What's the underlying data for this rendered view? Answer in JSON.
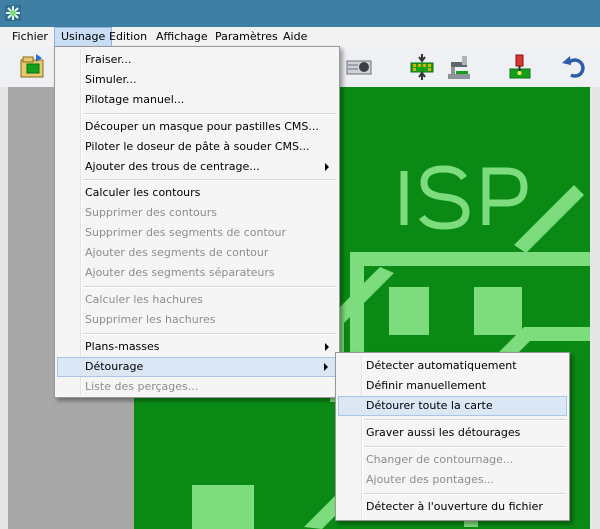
{
  "menubar": {
    "items": [
      {
        "label": "Fichier"
      },
      {
        "label": "Usinage"
      },
      {
        "label": "Edition"
      },
      {
        "label": "Affichage"
      },
      {
        "label": "Paramètres"
      },
      {
        "label": "Aide"
      }
    ]
  },
  "board": {
    "label": "ISP",
    "colors": {
      "board": "#0a8a14",
      "copper": "#7ddc7d"
    }
  },
  "usinage_menu": {
    "items": [
      {
        "label": "Fraiser..."
      },
      {
        "label": "Simuler..."
      },
      {
        "label": "Pilotage manuel..."
      },
      {
        "label": "Découper un masque pour pastilles CMS..."
      },
      {
        "label": "Piloter le doseur de pâte à souder CMS..."
      },
      {
        "label": "Ajouter des trous de centrage..."
      },
      {
        "label": "Calculer les contours"
      },
      {
        "label": "Supprimer des contours"
      },
      {
        "label": "Supprimer des segments de contour"
      },
      {
        "label": "Ajouter des segments de contour"
      },
      {
        "label": "Ajouter des segments séparateurs"
      },
      {
        "label": "Calculer les hachures"
      },
      {
        "label": "Supprimer les hachures"
      },
      {
        "label": "Plans-masses"
      },
      {
        "label": "Détourage"
      },
      {
        "label": "Liste des perçages..."
      }
    ]
  },
  "detourage_menu": {
    "items": [
      {
        "label": "Détecter automatiquement"
      },
      {
        "label": "Définir manuellement"
      },
      {
        "label": "Détourer toute la carte"
      },
      {
        "label": "Graver aussi les détourages"
      },
      {
        "label": "Changer de contournage..."
      },
      {
        "label": "Ajouter des pontages..."
      },
      {
        "label": "Détecter à l'ouverture du fichier"
      }
    ]
  }
}
